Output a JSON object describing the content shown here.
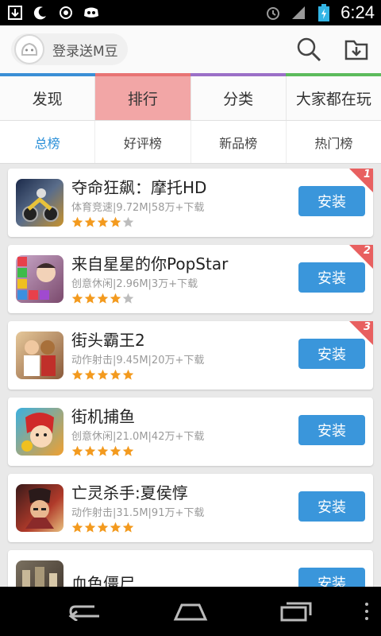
{
  "status_bar": {
    "time": "6:24",
    "left_icons": [
      "download-icon",
      "moon-icon",
      "eye-icon",
      "game-icon"
    ],
    "right_icons": [
      "alarm-icon",
      "signal-icon",
      "battery-icon"
    ]
  },
  "header": {
    "login_label": "登录送M豆",
    "actions": [
      "search-icon",
      "download-folder-icon"
    ]
  },
  "colors": {
    "accent_blue": "#3a96db",
    "tab_active": "#f2a6a6",
    "bar_blue": "#3a8fd6",
    "bar_red": "#e87474",
    "bar_purple": "#9b6fc7",
    "bar_green": "#5cbb5c",
    "star_gold": "#f39a1e"
  },
  "category_tabs": [
    {
      "label": "发现",
      "active": false
    },
    {
      "label": "排行",
      "active": true
    },
    {
      "label": "分类",
      "active": false
    },
    {
      "label": "大家都在玩",
      "active": false
    }
  ],
  "sub_tabs": [
    {
      "label": "总榜",
      "active": true
    },
    {
      "label": "好评榜",
      "active": false
    },
    {
      "label": "新品榜",
      "active": false
    },
    {
      "label": "热门榜",
      "active": false
    }
  ],
  "apps": [
    {
      "title": "夺命狂飙：摩托HD",
      "meta": "体育竞速|9.72M|58万+下载",
      "rating": 4,
      "rank": "1",
      "install": "安装"
    },
    {
      "title": "来自星星的你PopStar",
      "meta": "创意休闲|2.96M|3万+下载",
      "rating": 4,
      "rank": "2",
      "install": "安装"
    },
    {
      "title": "街头霸王2",
      "meta": "动作射击|9.45M|20万+下载",
      "rating": 5,
      "rank": "3",
      "install": "安装"
    },
    {
      "title": "街机捕鱼",
      "meta": "创意休闲|21.0M|42万+下载",
      "rating": 5,
      "rank": "",
      "install": "安装"
    },
    {
      "title": "亡灵杀手:夏侯惇",
      "meta": "动作射击|31.5M|91万+下载",
      "rating": 5,
      "rank": "",
      "install": "安装"
    },
    {
      "title": "血色僵尸",
      "meta": "",
      "rating": 0,
      "rank": "",
      "install": "安装"
    }
  ],
  "nav_bar": [
    "back-icon",
    "home-icon",
    "recent-apps-icon",
    "menu-icon"
  ]
}
